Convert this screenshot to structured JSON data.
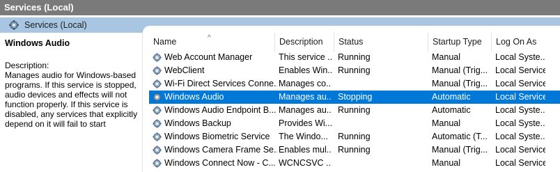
{
  "window": {
    "title": "Services (Local)"
  },
  "header": {
    "tab_label": "Services (Local)"
  },
  "details": {
    "service_name": "Windows Audio",
    "description_label": "Description:",
    "description_text": "Manages audio for Windows-based programs.  If this service is stopped, audio devices and effects will not function properly.  If this service is disabled, any services that explicitly depend on it will fail to start"
  },
  "grid": {
    "sort_indicator": "^",
    "columns": {
      "name": "Name",
      "description": "Description",
      "status": "Status",
      "startup_type": "Startup Type",
      "log_on_as": "Log On As"
    },
    "rows": [
      {
        "name": "Web Account Manager",
        "description": "This service ...",
        "status": "Running",
        "startup_type": "Manual",
        "log_on_as": "Local Syste..."
      },
      {
        "name": "WebClient",
        "description": "Enables Win...",
        "status": "Running",
        "startup_type": "Manual (Trig...",
        "log_on_as": "Local Service"
      },
      {
        "name": "Wi-Fi Direct Services Conne...",
        "description": "Manages co...",
        "status": "",
        "startup_type": "Manual (Trig...",
        "log_on_as": "Local Service"
      },
      {
        "name": "Windows Audio",
        "description": "Manages au...",
        "status": "Stopping",
        "startup_type": "Automatic",
        "log_on_as": "Local Service",
        "selected": true
      },
      {
        "name": "Windows Audio Endpoint B...",
        "description": "Manages au...",
        "status": "Running",
        "startup_type": "Automatic",
        "log_on_as": "Local Syste..."
      },
      {
        "name": "Windows Backup",
        "description": "Provides Wi...",
        "status": "",
        "startup_type": "Manual",
        "log_on_as": "Local Syste..."
      },
      {
        "name": "Windows Biometric Service",
        "description": "The Windo...",
        "status": "Running",
        "startup_type": "Automatic (T...",
        "log_on_as": "Local Syste..."
      },
      {
        "name": "Windows Camera Frame Se...",
        "description": "Enables mul...",
        "status": "Running",
        "startup_type": "Manual (Trig...",
        "log_on_as": "Local Service"
      },
      {
        "name": "Windows Connect Now - C...",
        "description": "WCNCSVC ...",
        "status": "",
        "startup_type": "Manual",
        "log_on_as": "Local Service"
      }
    ]
  },
  "colors": {
    "selection": "#0078d7",
    "header_band": "#a8c6e2",
    "titlebar": "#7a7a7a"
  },
  "icons": {
    "tab": "services-gear-icon",
    "row": "service-gear-icon"
  }
}
